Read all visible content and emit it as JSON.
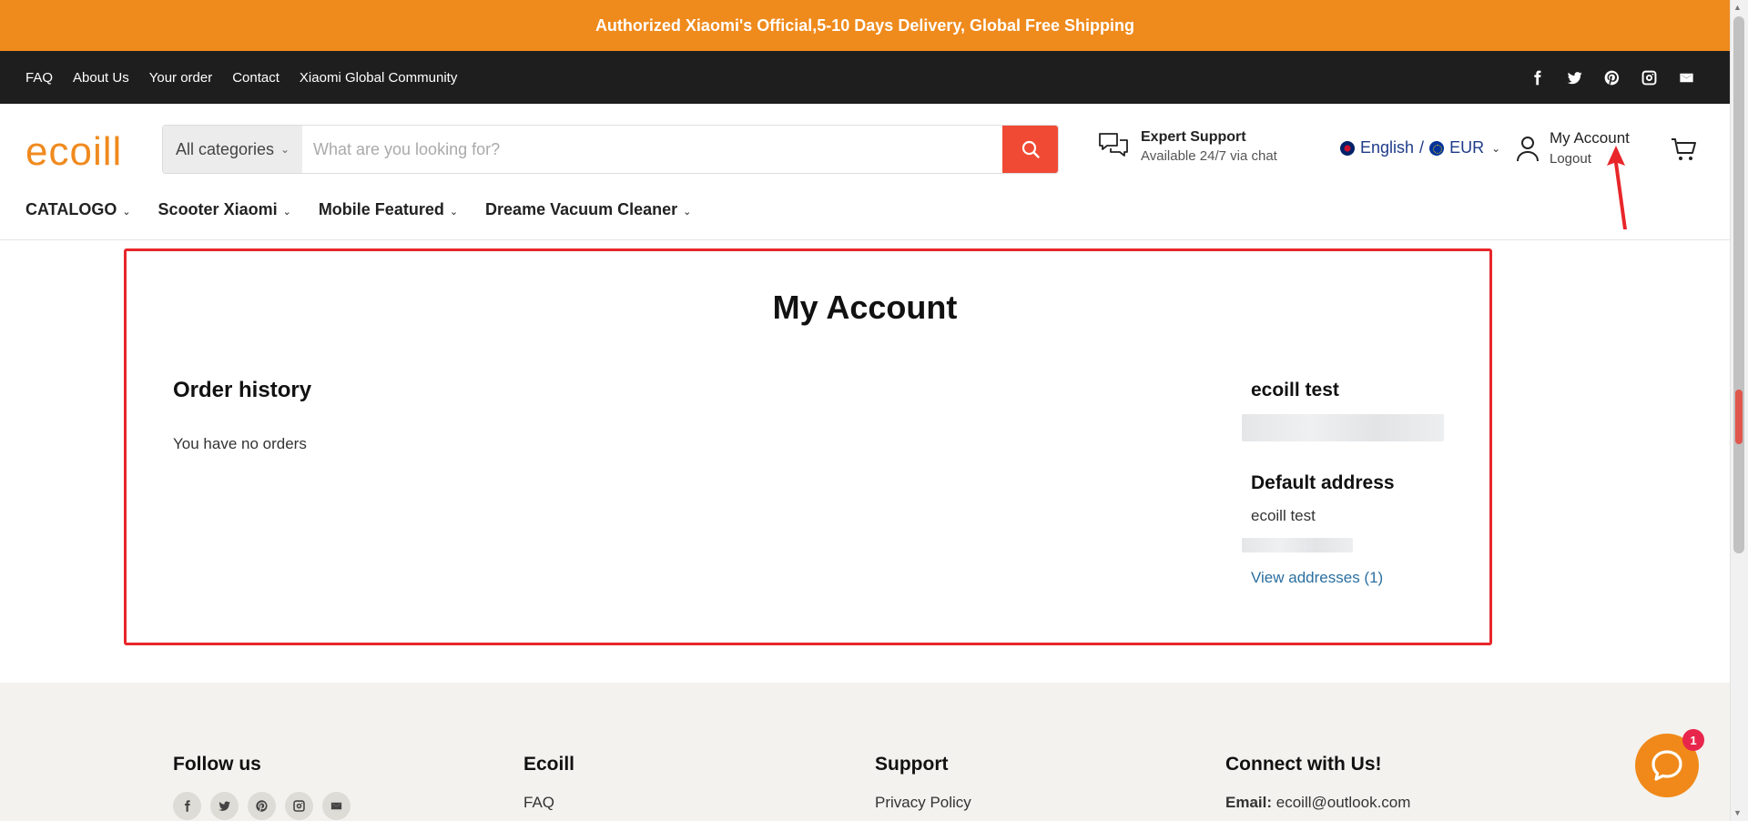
{
  "announcement": "Authorized Xiaomi's Official,5-10 Days Delivery, Global Free Shipping",
  "topbar": {
    "links": [
      "FAQ",
      "About Us",
      "Your order",
      "Contact",
      "Xiaomi Global Community"
    ],
    "social_icons": [
      "facebook-icon",
      "twitter-icon",
      "pinterest-icon",
      "instagram-icon",
      "email-icon"
    ]
  },
  "header": {
    "logo": "ecoill",
    "search": {
      "category": "All categories",
      "placeholder": "What are you looking for?"
    },
    "support": {
      "title": "Expert Support",
      "subtitle": "Available 24/7 via chat"
    },
    "locale": {
      "language": "English",
      "separator": "/",
      "currency": "EUR"
    },
    "account": {
      "label": "My Account",
      "logout": "Logout"
    },
    "nav": [
      "CATALOGO",
      "Scooter Xiaomi",
      "Mobile Featured",
      "Dreame Vacuum Cleaner"
    ]
  },
  "main": {
    "title": "My Account",
    "order_history": {
      "heading": "Order history",
      "empty": "You have no orders"
    },
    "customer": {
      "name": "ecoill test",
      "address_heading": "Default address",
      "address_name": "ecoill test",
      "view_addresses": "View addresses (1)"
    }
  },
  "footer": {
    "follow": "Follow us",
    "ecoill": {
      "heading": "Ecoill",
      "link": "FAQ"
    },
    "support": {
      "heading": "Support",
      "link": "Privacy Policy"
    },
    "connect": {
      "heading": "Connect with Us!",
      "email_label": "Email:",
      "email": "ecoill@outlook.com"
    }
  },
  "chat_badge": "1",
  "colors": {
    "announcement_bg": "#ef8a1c",
    "topbar_bg": "#1e1e1e",
    "search_button": "#f04a35",
    "logo": "#f08a1f",
    "highlight_frame": "#e8262a",
    "link": "#2a6fa0",
    "chat": "#f0891a"
  }
}
